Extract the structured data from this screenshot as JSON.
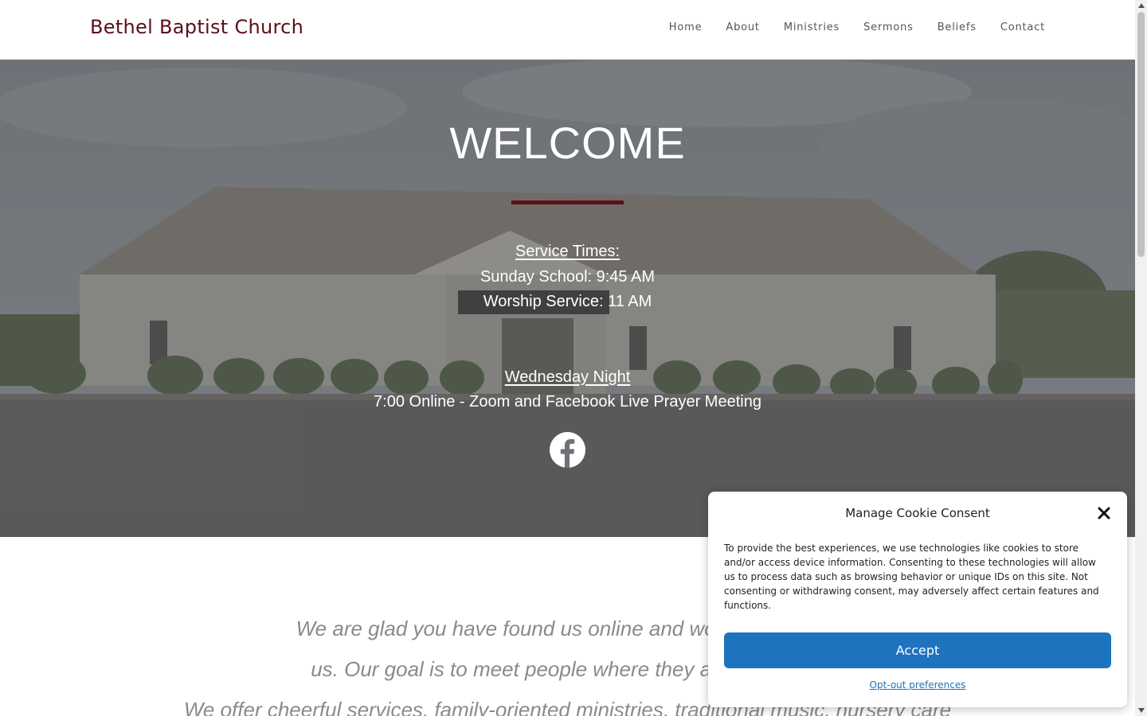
{
  "header": {
    "site_title": "Bethel Baptist Church",
    "nav": [
      "Home",
      "About",
      "Ministries",
      "Sermons",
      "Beliefs",
      "Contact"
    ]
  },
  "hero": {
    "title": "WELCOME",
    "service_heading": "Service Times:",
    "sunday_school": "Sunday School: 9:45 AM",
    "worship": "Worship Service: 11 AM",
    "wednesday_heading": "Wednesday Night",
    "wednesday_detail": "7:00 Online - Zoom and Facebook Live Prayer Meeting",
    "social_icon": "facebook-icon"
  },
  "intro": {
    "line1": "We are glad you have found us online and would love to ha",
    "line2": "us. Our goal is to meet people where they are in life and",
    "line3": "We offer cheerful services, family-oriented ministries, traditional music, nursery care"
  },
  "cookie": {
    "title": "Manage Cookie Consent",
    "text": "To provide the best experiences, we use technologies like cookies to store and/or access device information. Consenting to these technologies will allow us to process data such as browsing behavior or unique IDs on this site. Not consenting or withdrawing consent, may adversely affect certain features and functions.",
    "accept_label": "Accept",
    "optout_label": "Opt-out preferences"
  },
  "colors": {
    "brand": "#5a0f1a",
    "accept": "#1e73be"
  }
}
